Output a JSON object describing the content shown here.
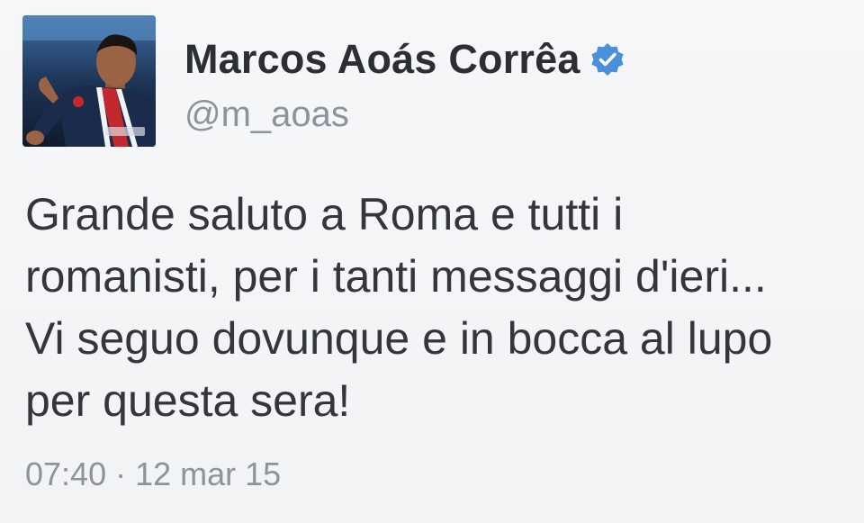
{
  "tweet": {
    "author": {
      "display_name": "Marcos Aoás Corrêa",
      "handle": "@m_aoas",
      "verified": true,
      "verified_icon": "verified-badge-icon",
      "verified_color": "#4a90d9"
    },
    "text": "Grande saluto a Roma e tutti i\nromanisti, per i tanti messaggi d'ieri...\nVi seguo dovunque e in bocca al lupo\nper questa sera!",
    "time": "07:40",
    "separator": "·",
    "date": "12 mar 15"
  }
}
